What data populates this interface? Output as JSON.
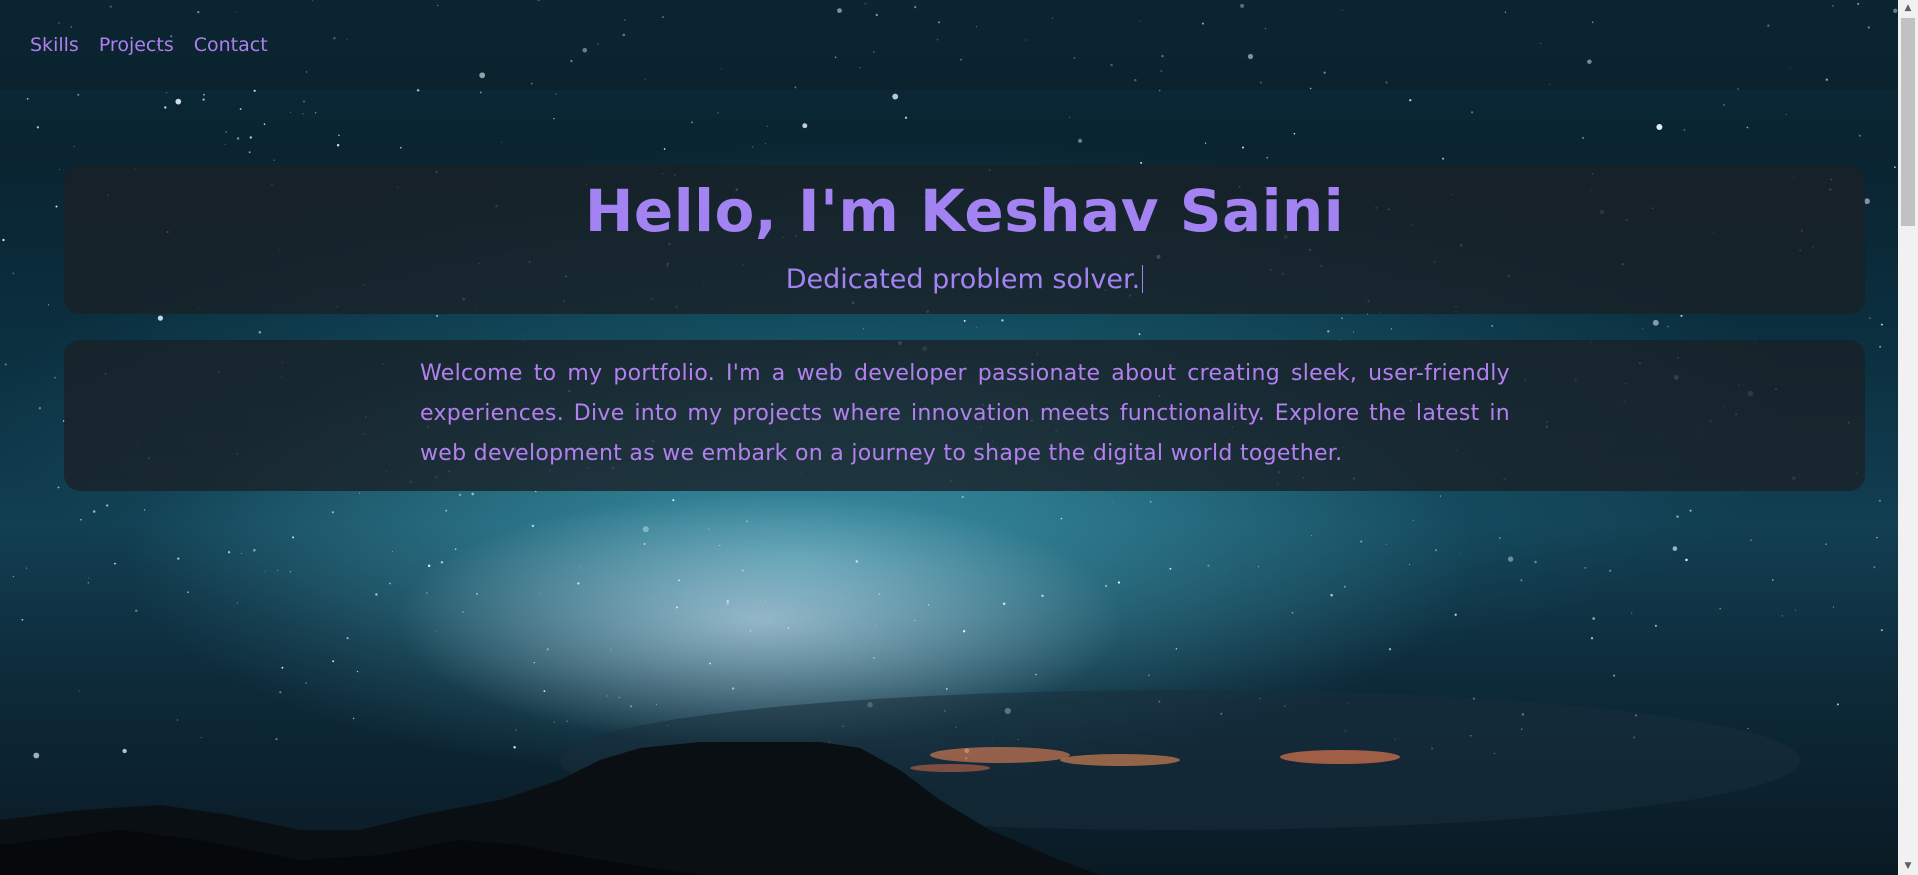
{
  "nav": {
    "items": [
      {
        "label": "Skills"
      },
      {
        "label": "Projects"
      },
      {
        "label": "Contact"
      }
    ]
  },
  "hero": {
    "title": "Hello, I'm Keshav Saini",
    "subtitle": "Dedicated problem solver."
  },
  "about": {
    "text": "Welcome to my portfolio. I'm a web developer passionate about creating sleek, user-friendly experiences. Dive into my projects where innovation meets functionality. Explore the latest in web development as we embark on a journey to shape the digital world together."
  },
  "colors": {
    "accent": "#a383f2",
    "nav_link": "#b07ef0",
    "card_bg": "#1a2026"
  },
  "icons": {
    "scroll_up": "triangle-up-icon",
    "scroll_down": "triangle-down-icon"
  }
}
